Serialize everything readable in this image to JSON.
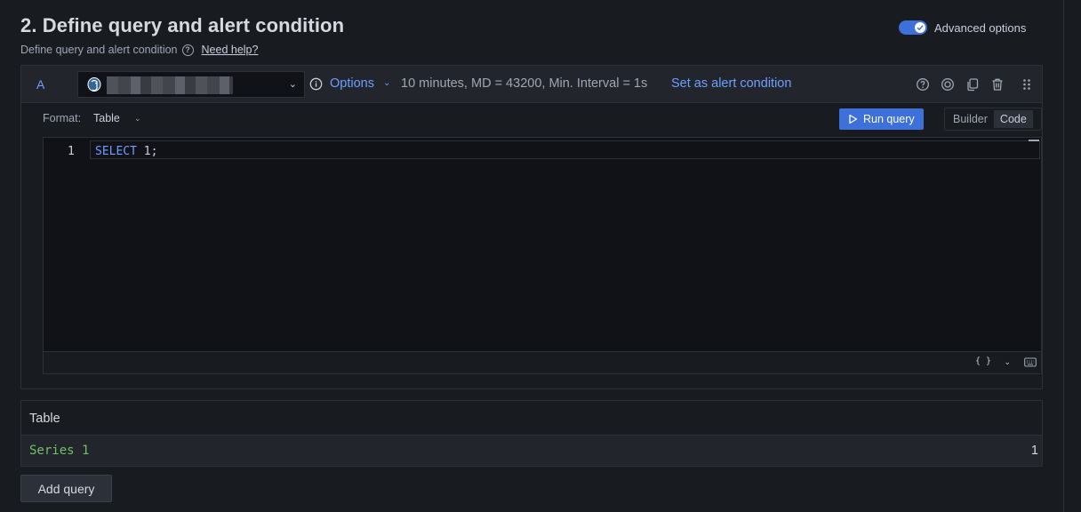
{
  "section": {
    "title": "2. Define query and alert condition",
    "subtitle": "Define query and alert condition",
    "help_link": "Need help?"
  },
  "advanced_options": {
    "label": "Advanced options",
    "enabled": true
  },
  "query": {
    "ref_id": "A",
    "datasource_icon": "postgresql-elephant-icon",
    "options_label": "Options",
    "options_summary": "10 minutes, MD = 43200, Min. Interval = 1s",
    "set_alert_label": "Set as alert condition",
    "format_label": "Format:",
    "format_value": "Table",
    "run_label": "Run query",
    "modes": [
      "Builder",
      "Code"
    ],
    "active_mode": "Code",
    "editor": {
      "line_number": "1",
      "keyword": "SELECT",
      "rest": " 1;"
    },
    "footer_braces": "{ }"
  },
  "results": {
    "header": "Table",
    "rows": [
      {
        "name": "Series 1",
        "value": "1"
      }
    ]
  },
  "add_query_label": "Add query",
  "colors": {
    "accent": "#3d71d9",
    "link": "#6e9fff",
    "series": "#73bf69",
    "background": "#181b1f"
  }
}
